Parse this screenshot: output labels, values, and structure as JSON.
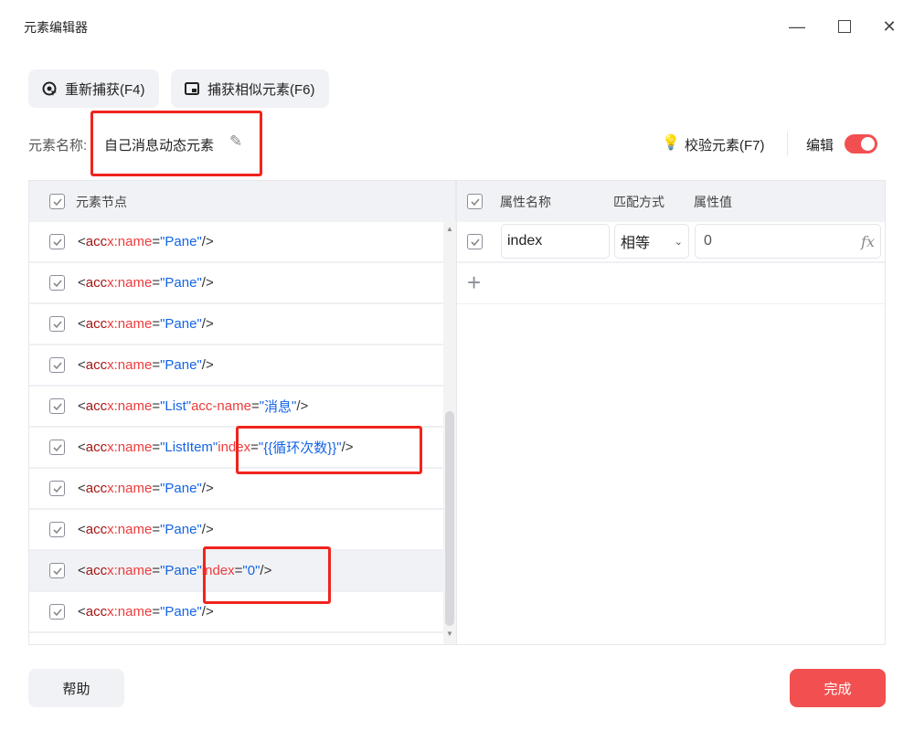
{
  "window": {
    "title": "元素编辑器",
    "minimize_icon": "minimize-icon",
    "maximize_icon": "maximize-icon",
    "close_icon": "close-icon"
  },
  "toolbar": {
    "recapture_label": "重新捕获(F4)",
    "capture_similar_label": "捕获相似元素(F6)"
  },
  "element_name": {
    "label": "元素名称:",
    "value": "自己消息动态元素"
  },
  "actions": {
    "validate_label": "校验元素(F7)",
    "edit_label": "编辑",
    "edit_enabled": true
  },
  "tree": {
    "header": "元素节点",
    "nodes": [
      {
        "tag": "acc",
        "attrs": [
          {
            "name": "x:name",
            "value": "Pane"
          }
        ],
        "checked": true
      },
      {
        "tag": "acc",
        "attrs": [
          {
            "name": "x:name",
            "value": "Pane"
          }
        ],
        "checked": true
      },
      {
        "tag": "acc",
        "attrs": [
          {
            "name": "x:name",
            "value": "Pane"
          }
        ],
        "checked": true
      },
      {
        "tag": "acc",
        "attrs": [
          {
            "name": "x:name",
            "value": "Pane"
          }
        ],
        "checked": true
      },
      {
        "tag": "acc",
        "attrs": [
          {
            "name": "x:name",
            "value": "List"
          },
          {
            "name": "acc-name",
            "value": "消息"
          }
        ],
        "checked": true
      },
      {
        "tag": "acc",
        "attrs": [
          {
            "name": "x:name",
            "value": "ListItem"
          },
          {
            "name": "index",
            "value": "{{循环次数}}"
          }
        ],
        "checked": true
      },
      {
        "tag": "acc",
        "attrs": [
          {
            "name": "x:name",
            "value": "Pane"
          }
        ],
        "checked": true
      },
      {
        "tag": "acc",
        "attrs": [
          {
            "name": "x:name",
            "value": "Pane"
          }
        ],
        "checked": true
      },
      {
        "tag": "acc",
        "attrs": [
          {
            "name": "x:name",
            "value": "Pane"
          },
          {
            "name": "index",
            "value": "0"
          }
        ],
        "checked": true,
        "selected": true
      },
      {
        "tag": "acc",
        "attrs": [
          {
            "name": "x:name",
            "value": "Pane"
          }
        ],
        "checked": true
      }
    ]
  },
  "attributes": {
    "headers": {
      "name": "属性名称",
      "match": "匹配方式",
      "value": "属性值"
    },
    "rows": [
      {
        "name": "index",
        "match": "相等",
        "value": "0",
        "checked": true
      }
    ]
  },
  "footer": {
    "help_label": "帮助",
    "done_label": "完成"
  },
  "colors": {
    "accent": "#f25050",
    "highlight_box": "#f0241e"
  }
}
